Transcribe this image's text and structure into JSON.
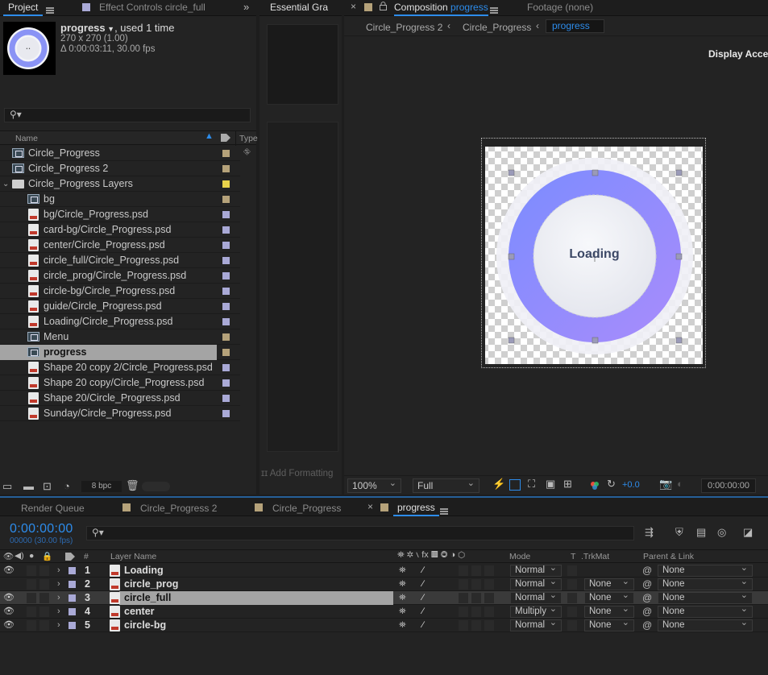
{
  "project_panel": {
    "tabs": [
      {
        "label": "Project",
        "active": true
      },
      {
        "label": "Effect Controls circle_full",
        "active": false
      }
    ],
    "preview": {
      "name": "progress",
      "used": ", used 1 time",
      "dims": "270 x 270 (1.00)",
      "duration": "Δ 0:00:03:11, 30.00 fps"
    },
    "columns": {
      "name": "Name",
      "type": "Type"
    },
    "items": [
      {
        "label": "Circle_Progress",
        "icon": "comp-icon",
        "indent": 0,
        "color": "#b5a27a",
        "selected": false
      },
      {
        "label": "Circle_Progress 2",
        "icon": "comp-icon",
        "indent": 0,
        "color": "#b5a27a",
        "selected": false
      },
      {
        "label": "Circle_Progress Layers",
        "icon": "folder-icon",
        "indent": 0,
        "color": "#e8d24a",
        "selected": false
      },
      {
        "label": "bg",
        "icon": "comp-icon",
        "indent": 1,
        "color": "#b5a27a",
        "selected": false
      },
      {
        "label": "bg/Circle_Progress.psd",
        "icon": "psd-icon",
        "indent": 1,
        "color": "#a9a9d6",
        "selected": false
      },
      {
        "label": "card-bg/Circle_Progress.psd",
        "icon": "psd-icon",
        "indent": 1,
        "color": "#a9a9d6",
        "selected": false
      },
      {
        "label": "center/Circle_Progress.psd",
        "icon": "psd-icon",
        "indent": 1,
        "color": "#a9a9d6",
        "selected": false
      },
      {
        "label": "circle_full/Circle_Progress.psd",
        "icon": "psd-icon",
        "indent": 1,
        "color": "#a9a9d6",
        "selected": false
      },
      {
        "label": "circle_prog/Circle_Progress.psd",
        "icon": "psd-icon",
        "indent": 1,
        "color": "#a9a9d6",
        "selected": false
      },
      {
        "label": "circle-bg/Circle_Progress.psd",
        "icon": "psd-icon",
        "indent": 1,
        "color": "#a9a9d6",
        "selected": false
      },
      {
        "label": "guide/Circle_Progress.psd",
        "icon": "psd-icon",
        "indent": 1,
        "color": "#a9a9d6",
        "selected": false
      },
      {
        "label": "Loading/Circle_Progress.psd",
        "icon": "psd-icon",
        "indent": 1,
        "color": "#a9a9d6",
        "selected": false
      },
      {
        "label": "Menu",
        "icon": "comp-icon",
        "indent": 1,
        "color": "#b5a27a",
        "selected": false
      },
      {
        "label": "progress",
        "icon": "comp-icon",
        "indent": 1,
        "color": "#b5a27a",
        "selected": true
      },
      {
        "label": "Shape 20 copy 2/Circle_Progress.psd",
        "icon": "psd-icon",
        "indent": 1,
        "color": "#a9a9d6",
        "selected": false
      },
      {
        "label": "Shape 20 copy/Circle_Progress.psd",
        "icon": "psd-icon",
        "indent": 1,
        "color": "#a9a9d6",
        "selected": false
      },
      {
        "label": "Shape 20/Circle_Progress.psd",
        "icon": "psd-icon",
        "indent": 1,
        "color": "#a9a9d6",
        "selected": false
      },
      {
        "label": "Sunday/Circle_Progress.psd",
        "icon": "psd-icon",
        "indent": 1,
        "color": "#a9a9d6",
        "selected": false
      }
    ],
    "footer": {
      "bpc": "8 bpc"
    }
  },
  "essential_graphics": {
    "tab": "Essential Gra",
    "add_formatting": "Add Formatting"
  },
  "composition_panel": {
    "tabs": [
      {
        "label": "Composition",
        "name": "progress",
        "active": true
      },
      {
        "label": "Footage",
        "name": "(none)",
        "active": false
      }
    ],
    "breadcrumbs": [
      "Circle_Progress 2",
      "Circle_Progress",
      "progress"
    ],
    "display_accel": "Display Acceler",
    "canvas_text": "Loading",
    "toolbar": {
      "zoom": "100%",
      "resolution": "Full",
      "exposure": "+0.0",
      "timecode": "0:00:00:00"
    }
  },
  "timeline_panel": {
    "tabs": [
      {
        "label": "Render Queue",
        "active": false
      },
      {
        "label": "Circle_Progress 2",
        "active": false
      },
      {
        "label": "Circle_Progress",
        "active": false
      },
      {
        "label": "progress",
        "active": true
      }
    ],
    "timecode": "0:00:00:00",
    "frames": "00000 (30.00 fps)",
    "columns": {
      "num": "#",
      "layer_name": "Layer Name",
      "mode": "Mode",
      "t": "T",
      "trkmat": ".TrkMat",
      "parent": "Parent & Link"
    },
    "layers": [
      {
        "num": "1",
        "name": "Loading",
        "mode": "Normal",
        "trkmat": "",
        "parent": "None",
        "selected": false
      },
      {
        "num": "2",
        "name": "circle_prog",
        "mode": "Normal",
        "trkmat": "None",
        "parent": "None",
        "selected": false
      },
      {
        "num": "3",
        "name": "circle_full",
        "mode": "Normal",
        "trkmat": "None",
        "parent": "None",
        "selected": true
      },
      {
        "num": "4",
        "name": "center",
        "mode": "Multiply",
        "trkmat": "None",
        "parent": "None",
        "selected": false
      },
      {
        "num": "5",
        "name": "circle-bg",
        "mode": "Normal",
        "trkmat": "None",
        "parent": "None",
        "selected": false
      }
    ]
  },
  "colors": {
    "accent": "#2d8ceb",
    "ring_start": "#7b8cff",
    "ring_end": "#a98cfb",
    "label_psd": "#a9a9d6",
    "label_comp": "#b5a27a"
  }
}
